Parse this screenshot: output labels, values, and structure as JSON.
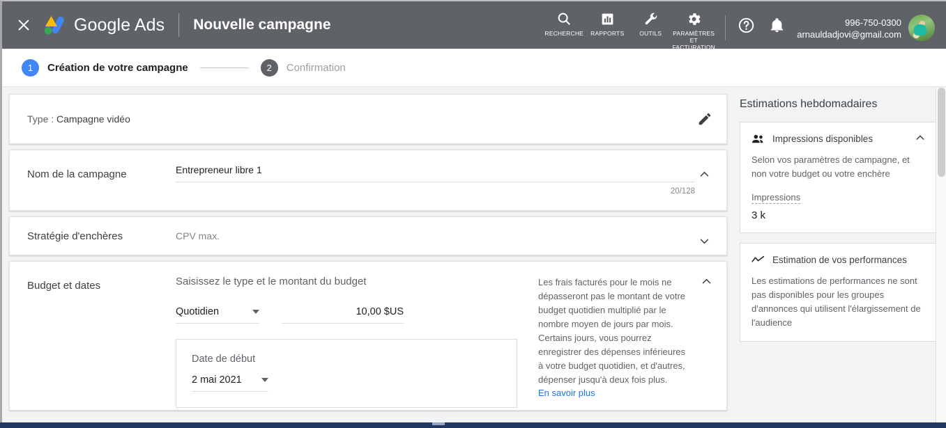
{
  "appbar": {
    "close_icon": "close-icon",
    "logo_icon": "google-ads-logo",
    "brand": "Google Ads",
    "page_title": "Nouvelle campagne",
    "tools": [
      {
        "icon": "search-icon",
        "label": "RECHERCHE"
      },
      {
        "icon": "reports-icon",
        "label": "RAPPORTS"
      },
      {
        "icon": "wrench-icon",
        "label": "OUTILS"
      },
      {
        "icon": "gear-icon",
        "label": "PARAMÈTRES\nET\nFACTURATION"
      }
    ],
    "help_icon": "help-icon",
    "bell_icon": "notifications-icon",
    "account_id": "996-750-0300",
    "account_email": "arnauldadjovi@gmail.com",
    "avatar_icon": "avatar"
  },
  "stepper": {
    "steps": [
      {
        "number": "1",
        "label": "Création de votre campagne",
        "state": "active"
      },
      {
        "number": "2",
        "label": "Confirmation",
        "state": "inactive"
      }
    ]
  },
  "type_card": {
    "label": "Type :",
    "value": "Campagne vidéo",
    "edit_icon": "pencil-icon"
  },
  "name_card": {
    "label": "Nom de la campagne",
    "value": "Entrepreneur libre 1",
    "placeholder": "Nom de la campagne",
    "counter": "20/128",
    "chevron": "chevron-up-icon"
  },
  "bidding_card": {
    "label": "Stratégie d'enchères",
    "value": "CPV max.",
    "chevron": "chevron-down-icon"
  },
  "budget_card": {
    "label": "Budget et dates",
    "hint": "Saisissez le type et le montant du budget",
    "budget_type": "Quotidien",
    "budget_amount": "10,00 $US",
    "note": "Les frais facturés pour le mois ne dépasseront pas le montant de votre budget quotidien multiplié par le nombre moyen de jours par mois. Certains jours, vous pourrez enregistrer des dépenses inférieures à votre budget quotidien, et d'autres, dépenser jusqu'à deux fois plus.",
    "note_link": "En savoir plus",
    "chevron": "chevron-up-icon",
    "start_date_label": "Date de début",
    "start_date_value": "2 mai 2021"
  },
  "rail": {
    "title": "Estimations hebdomadaires",
    "cards": [
      {
        "icon": "people-icon",
        "title": "Impressions disponibles",
        "chevron": "chevron-up-icon",
        "body": "Selon vos paramètres de campagne, et non votre budget ou votre enchère",
        "metric_name": "Impressions",
        "metric_value": "3 k"
      },
      {
        "icon": "trending-line-icon",
        "title": "Estimation de vos performances",
        "body": "Les estimations de performances ne sont pas disponibles pour les groupes d'annonces qui utilisent l'élargissement de l'audience"
      }
    ]
  },
  "colors": {
    "appbar": "#5f6368",
    "active_step": "#4285f4",
    "inactive_step": "#5f6368",
    "link": "#1a73e8",
    "page_bg": "#f1f3f4",
    "taskbar": "#1f3864"
  }
}
